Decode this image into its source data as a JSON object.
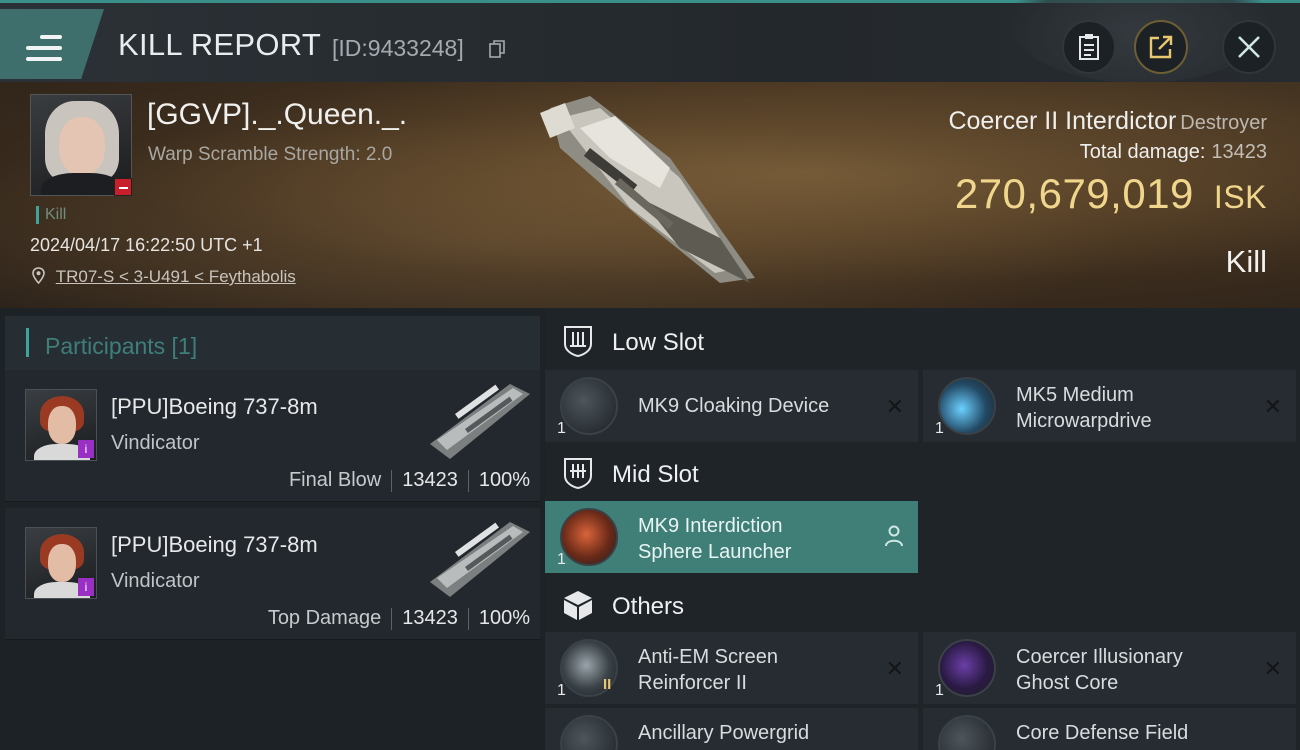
{
  "header": {
    "title": "KILL REPORT",
    "report_id": "[ID:9433248]"
  },
  "victim": {
    "name": "[GGVP]._.Queen._.",
    "subtitle": "Warp Scramble Strength: 2.0",
    "tag": "Kill",
    "timestamp": "2024/04/17 16:22:50 UTC +1",
    "location": "TR07-S < 3-U491 < Feythabolis"
  },
  "ship": {
    "name": "Coercer II Interdictor",
    "class": "Destroyer",
    "total_damage_label": "Total damage:",
    "total_damage": "13423",
    "isk_value": "270,679,019",
    "isk_unit": "ISK",
    "result": "Kill"
  },
  "participants": {
    "header": "Participants [1]",
    "rows": [
      {
        "name": "[PPU]Boeing 737-8m",
        "ship": "Vindicator",
        "role": "Final Blow",
        "damage": "13423",
        "percent": "100%"
      },
      {
        "name": "[PPU]Boeing 737-8m",
        "ship": "Vindicator",
        "role": "Top Damage",
        "damage": "13423",
        "percent": "100%"
      }
    ]
  },
  "fitting": {
    "low_slot_label": "Low Slot",
    "mid_slot_label": "Mid Slot",
    "others_label": "Others",
    "low_slot": [
      {
        "name": "MK9 Cloaking Device",
        "qty": "1"
      },
      {
        "name_line1": "MK5 Medium",
        "name_line2": "Microwarpdrive",
        "qty": "1"
      }
    ],
    "mid_slot": [
      {
        "name_line1": "MK9 Interdiction",
        "name_line2": "Sphere Launcher",
        "qty": "1"
      }
    ],
    "others": [
      {
        "name_line1": "Anti-EM Screen",
        "name_line2": "Reinforcer II",
        "qty": "1",
        "tier": "II"
      },
      {
        "name_line1": "Coercer Illusionary",
        "name_line2": "Ghost Core",
        "qty": "1"
      },
      {
        "name_line1": "Ancillary Powergrid",
        "qty": ""
      },
      {
        "name_line1": "Core Defense Field",
        "qty": ""
      }
    ]
  },
  "icons": {
    "remove": "✕"
  },
  "colors": {
    "accent_teal": "#3ea398",
    "isk_gold": "#efd68c",
    "selected_item": "#3f7f78",
    "kill_badge_red": "#c8202a"
  }
}
